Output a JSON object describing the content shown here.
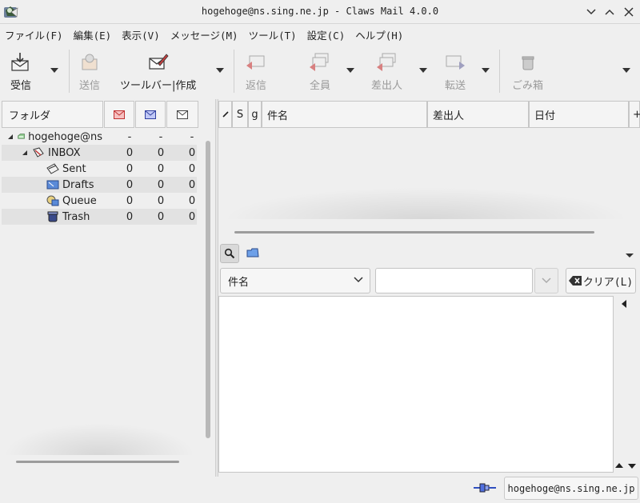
{
  "window": {
    "title": "hogehoge@ns.sing.ne.jp - Claws Mail 4.0.0"
  },
  "menu": [
    "ファイル(F)",
    "編集(E)",
    "表示(V)",
    "メッセージ(M)",
    "ツール(T)",
    "設定(C)",
    "ヘルプ(H)"
  ],
  "toolbar": {
    "receive": "受信",
    "send": "送信",
    "compose": "ツールバー|作成",
    "reply": "返信",
    "reply_all": "全員",
    "reply_sender": "差出人",
    "forward": "転送",
    "trash": "ごみ箱"
  },
  "folder_pane": {
    "header": "フォルダ",
    "rows": [
      {
        "name": "hogehoge@ns",
        "new": "-",
        "unread": "-",
        "total": "-"
      },
      {
        "name": "INBOX",
        "new": "0",
        "unread": "0",
        "total": "0"
      },
      {
        "name": "Sent",
        "new": "0",
        "unread": "0",
        "total": "0"
      },
      {
        "name": "Drafts",
        "new": "0",
        "unread": "0",
        "total": "0"
      },
      {
        "name": "Queue",
        "new": "0",
        "unread": "0",
        "total": "0"
      },
      {
        "name": "Trash",
        "new": "0",
        "unread": "0",
        "total": "0"
      }
    ]
  },
  "message_list": {
    "col_status": "S",
    "col_attach": "g",
    "col_subject": "件名",
    "col_from": "差出人",
    "col_date": "日付",
    "col_more": "+"
  },
  "search": {
    "field_selected": "件名",
    "query": "",
    "clear_label": "クリア(L)"
  },
  "status": {
    "account": "hogehoge@ns.sing.ne.jp"
  },
  "colors": {
    "window_bg": "#efefef",
    "header_bg": "#f4f4f4",
    "alt_row": "#e2e2e2",
    "accent_blue": "#3d6fd6"
  }
}
